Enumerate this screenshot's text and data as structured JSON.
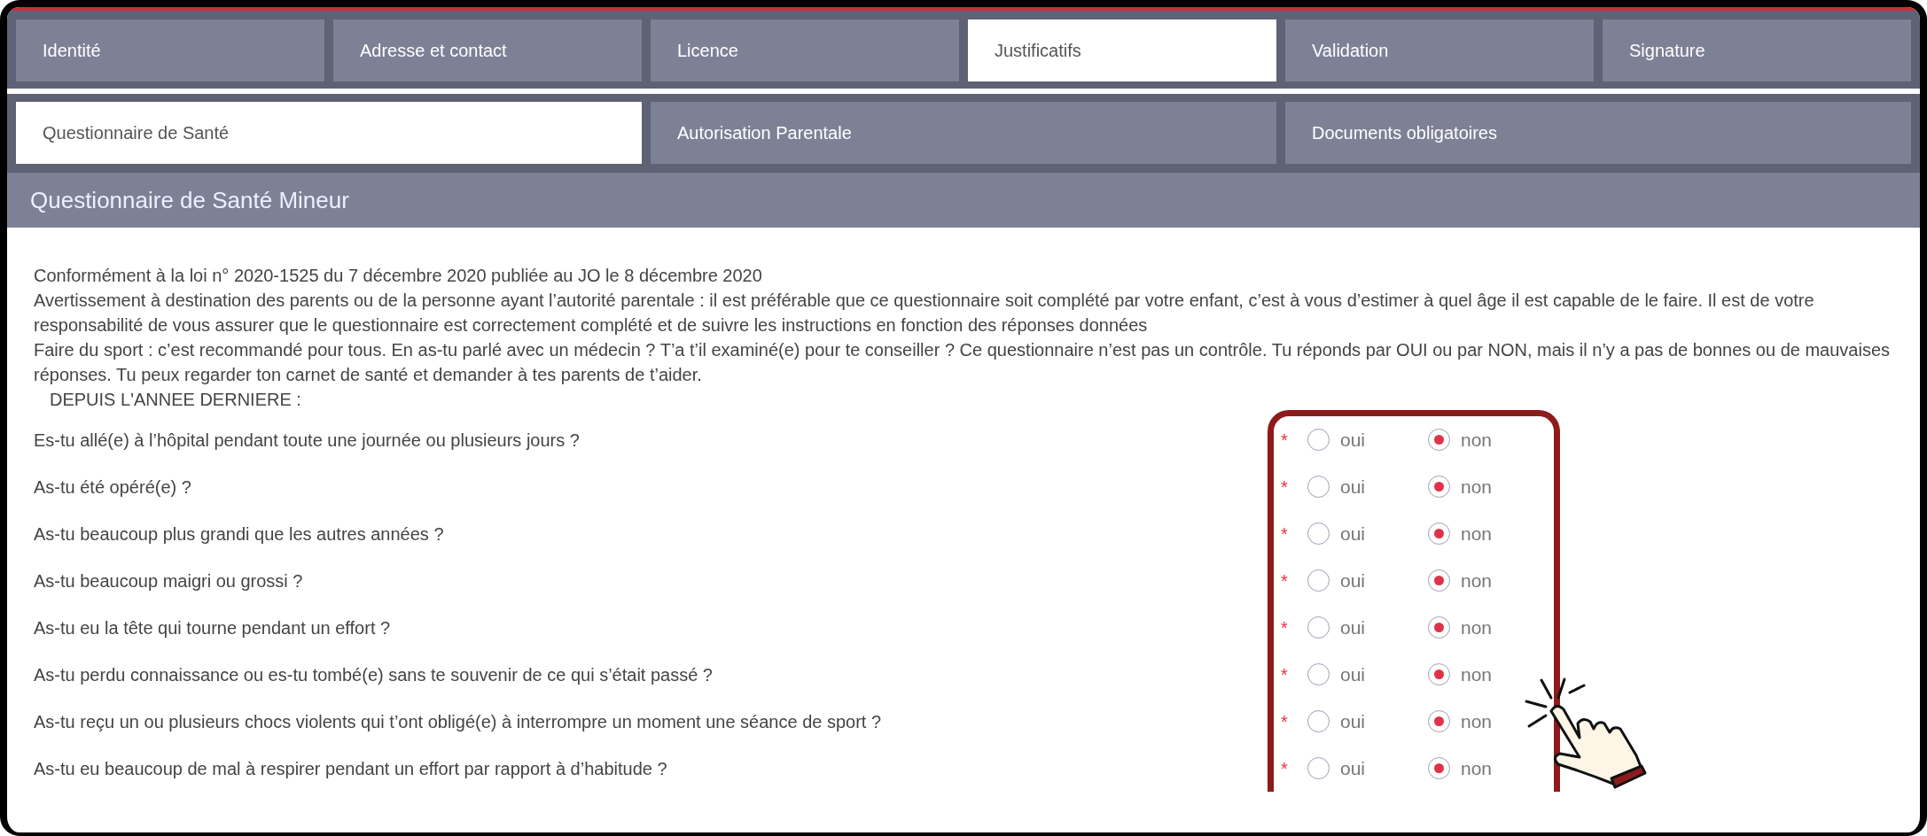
{
  "main_tabs": [
    {
      "label": "Identité",
      "selected": false
    },
    {
      "label": "Adresse et contact",
      "selected": false
    },
    {
      "label": "Licence",
      "selected": false
    },
    {
      "label": "Justificatifs",
      "selected": true
    },
    {
      "label": "Validation",
      "selected": false
    },
    {
      "label": "Signature",
      "selected": false
    }
  ],
  "sub_tabs": [
    {
      "label": "Questionnaire de Santé",
      "selected": true
    },
    {
      "label": "Autorisation Parentale",
      "selected": false
    },
    {
      "label": "Documents obligatoires",
      "selected": false
    }
  ],
  "section_title": "Questionnaire de Santé Mineur",
  "intro": [
    "Conformément à la loi n° 2020-1525 du 7 décembre 2020 publiée au JO le 8 décembre 2020",
    "Avertissement à destination des parents ou de la personne ayant l’autorité parentale : il est préférable que ce questionnaire soit complété par votre enfant, c’est à vous d’estimer à quel âge il est capable de le faire. Il est de votre responsabilité de vous assurer que le questionnaire est correctement complété et de suivre les instructions en fonction des réponses données",
    "Faire du sport : c’est recommandé pour tous. En as-tu parlé avec un médecin ? T’a t’il examiné(e) pour te conseiller ? Ce questionnaire n’est pas un contrôle. Tu réponds par OUI ou par NON, mais il n’y a pas de bonnes ou de mauvaises réponses. Tu peux regarder ton carnet de santé et demander à tes parents de t’aider."
  ],
  "subheading": "DEPUIS L'ANNEE DERNIERE :",
  "questions": [
    {
      "text": "Es-tu allé(e) à l’hôpital pendant toute une journée ou plusieurs jours ?",
      "marker": "*",
      "options": [
        {
          "label": "oui",
          "selected": false
        },
        {
          "label": "non",
          "selected": true
        }
      ]
    },
    {
      "text": "As-tu été opéré(e) ?",
      "marker": "*",
      "options": [
        {
          "label": "oui",
          "selected": false
        },
        {
          "label": "non",
          "selected": true
        }
      ]
    },
    {
      "text": "As-tu beaucoup plus grandi que les autres années ?",
      "marker": "*",
      "options": [
        {
          "label": "oui",
          "selected": false
        },
        {
          "label": "non",
          "selected": true
        }
      ]
    },
    {
      "text": "As-tu beaucoup maigri ou grossi ?",
      "marker": "*",
      "options": [
        {
          "label": "oui",
          "selected": false
        },
        {
          "label": "non",
          "selected": true
        }
      ]
    },
    {
      "text": "As-tu eu la tête qui tourne pendant un effort ?",
      "marker": "*",
      "options": [
        {
          "label": "oui",
          "selected": false
        },
        {
          "label": "non",
          "selected": true
        }
      ]
    },
    {
      "text": "As-tu perdu connaissance ou es-tu tombé(e) sans te souvenir de ce qui s’était passé ?",
      "marker": "*",
      "options": [
        {
          "label": "oui",
          "selected": false
        },
        {
          "label": "non",
          "selected": true
        }
      ]
    },
    {
      "text": "As-tu reçu un ou plusieurs chocs violents qui t’ont obligé(e) à interrompre un moment une séance de sport ?",
      "marker": "*",
      "options": [
        {
          "label": "oui",
          "selected": false
        },
        {
          "label": "non",
          "selected": true
        }
      ]
    },
    {
      "text": "As-tu eu beaucoup de mal à respirer pendant un effort par rapport à d’habitude ?",
      "marker": "*",
      "options": [
        {
          "label": "oui",
          "selected": false
        },
        {
          "label": "non",
          "selected": true
        }
      ]
    }
  ]
}
